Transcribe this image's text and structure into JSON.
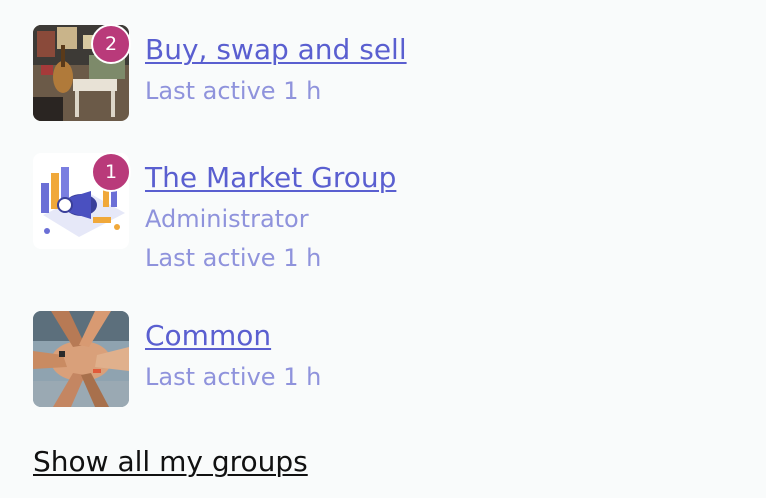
{
  "groups": [
    {
      "name": "Buy, swap and sell",
      "badge": "2",
      "last_active": "Last active 1 h"
    },
    {
      "name": "The Market Group",
      "badge": "1",
      "role": "Administrator",
      "last_active": "Last active 1 h"
    },
    {
      "name": "Common",
      "last_active": "Last active 1 h"
    }
  ],
  "show_all_label": "Show all my groups",
  "colors": {
    "link": "#5a5fd0",
    "meta": "#8f93dc",
    "badge": "#b93a7a",
    "background": "#f9fbfb"
  }
}
